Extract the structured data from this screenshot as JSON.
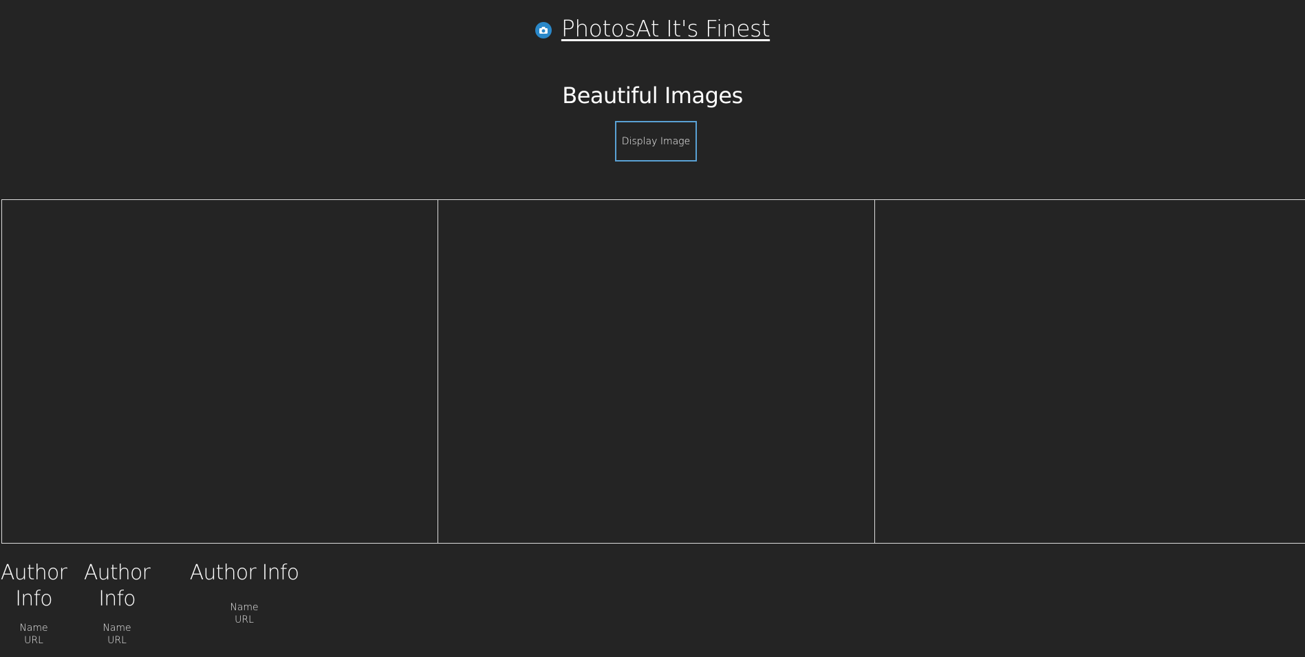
{
  "header": {
    "brand_icon": "camera-icon",
    "brand_title": "PhotosAt It's Finest",
    "brand_color": "#2a88c9"
  },
  "hero": {
    "title": "Beautiful Images",
    "button_label": "Display Image",
    "button_border_color": "#5aa2d6"
  },
  "gallery": {
    "panels": [
      {
        "label": ""
      },
      {
        "label": ""
      },
      {
        "label": ""
      }
    ]
  },
  "authors": [
    {
      "title": "Author Info",
      "name": "Name",
      "url": "URL"
    },
    {
      "title": "Author Info",
      "name": "Name",
      "url": "URL"
    },
    {
      "title": "Author Info",
      "name": "Name",
      "url": "URL"
    }
  ],
  "colors": {
    "background": "#242424",
    "text": "#ffffff",
    "border": "#dddddd"
  }
}
